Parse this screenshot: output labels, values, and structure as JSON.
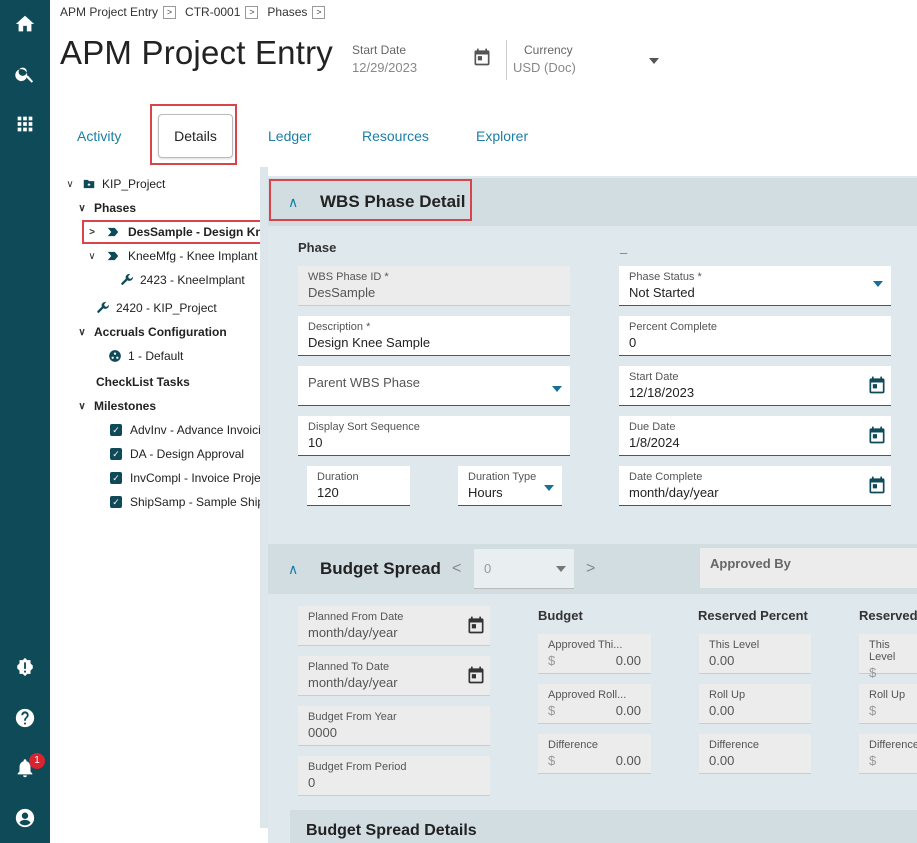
{
  "breadcrumb": [
    "APM Project Entry",
    "CTR-0001",
    "Phases"
  ],
  "page_title": "APM Project Entry",
  "header": {
    "start_date_label": "Start Date",
    "start_date_value": "12/29/2023",
    "currency_label": "Currency",
    "currency_value": "USD (Doc)"
  },
  "tabs": [
    "Activity",
    "Details",
    "Ledger",
    "Resources",
    "Explorer"
  ],
  "tree": {
    "root": "KIP_Project",
    "phases_label": "Phases",
    "phase_1": "DesSample - Design Knee S",
    "phase_2": "KneeMfg - Knee Implant M",
    "phase_2_child": "2423 - KneeImplant",
    "project_item": "2420 - KIP_Project",
    "accruals_label": "Accruals Configuration",
    "accrual_default": "1 - Default",
    "checklist_label": "CheckList Tasks",
    "milestones_label": "Milestones",
    "milestones": [
      "AdvInv - Advance Invoicing",
      "DA - Design Approval",
      "InvCompl - Invoice Project",
      "ShipSamp - Sample Shipm"
    ]
  },
  "wbs": {
    "title": "WBS Phase Detail",
    "phase_group": "Phase",
    "second_group": "_",
    "wbs_phase_id_label": "WBS Phase ID *",
    "wbs_phase_id_value": "DesSample",
    "description_label": "Description *",
    "description_value": "Design Knee Sample",
    "parent_label": "Parent WBS Phase",
    "sort_label": "Display Sort Sequence",
    "sort_value": "10",
    "duration_label": "Duration",
    "duration_value": "120",
    "duration_type_label": "Duration Type",
    "duration_type_value": "Hours",
    "status_label": "Phase Status *",
    "status_value": "Not Started",
    "percent_label": "Percent Complete",
    "percent_value": "0",
    "start_label": "Start Date",
    "start_value": "12/18/2023",
    "due_label": "Due Date",
    "due_value": "1/8/2024",
    "complete_label": "Date Complete",
    "complete_value": "month/day/year"
  },
  "budget": {
    "title": "Budget Spread",
    "period_value": "0",
    "approved_by_label": "Approved By",
    "planned_from_label": "Planned From Date",
    "planned_from_value": "month/day/year",
    "planned_to_label": "Planned To Date",
    "planned_to_value": "month/day/year",
    "from_year_label": "Budget From Year",
    "from_year_value": "0000",
    "from_period_label": "Budget From Period",
    "from_period_value": "0",
    "budget_group": "Budget",
    "approved_this_label": "Approved Thi...",
    "approved_this_value": "0.00",
    "approved_roll_label": "Approved Roll...",
    "approved_roll_value": "0.00",
    "difference_label": "Difference",
    "difference_value": "0.00",
    "currency_symbol": "$",
    "reserved_pct_group": "Reserved Percent",
    "this_level_label": "This Level",
    "this_level_value": "0.00",
    "roll_up_label": "Roll Up",
    "roll_up_value": "0.00",
    "rp_difference_label": "Difference",
    "rp_difference_value": "0.00",
    "reserved_amt_group": "ReservedA",
    "ra_this_level_label": "This Level",
    "ra_roll_up_label": "Roll Up",
    "ra_difference_label": "Difference",
    "details_title": "Budget Spread Details"
  },
  "notifications_count": "1"
}
